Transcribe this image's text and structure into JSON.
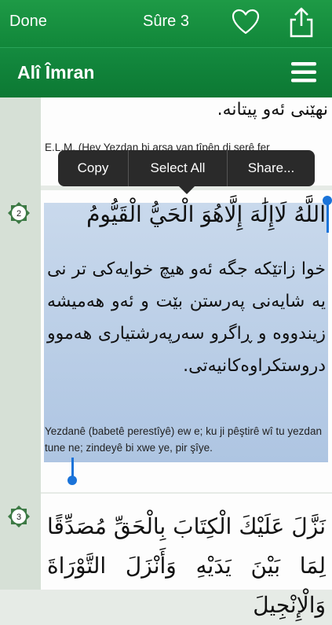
{
  "navbar": {
    "done_label": "Done",
    "title": "Sûre 3",
    "heart_icon": "heart-icon",
    "share_icon": "share-icon"
  },
  "surah_header": {
    "title": "Alî Îmran",
    "menu_icon": "hamburger-menu-icon"
  },
  "context_menu": {
    "items": [
      "Copy",
      "Select All",
      "Share..."
    ]
  },
  "verses": [
    {
      "kurdish": "نهێنی ئەو پیتانە.",
      "latin": "E.L.M. (Hey Yezdan bi arsa van tîpên di serê fer"
    },
    {
      "number": "2",
      "arabic": "اللَّهُ لَاإِلَٰهَ إِلَّاهُوَ الْحَيُّ الْقَيُّومُ",
      "kurdish": "خوا زاتێکە جگە ئەو هیچ خوایەکی تر نی یە شایەنی پەرستن بێت و ئەو هەمیشە زیندووە و ڕاگرو سەرپەرشتیاری هەموو دروستکراوەکانیەتی.",
      "latin": "Yezdanê (babetê perestîyê) ew e; ku ji pêştirê wî tu yezdan tune ne; zindeyê bi xwe ye, pir şîye."
    },
    {
      "number": "3",
      "arabic": "نَزَّلَ عَلَيْكَ الْكِتَابَ بِالْحَقِّ مُصَدِّقًا لِمَا بَيْنَ يَدَيْهِ وَأَنْزَلَ التَّوْرَاةَ وَالْإِنْجِيلَ"
    }
  ],
  "colors": {
    "nav_green": "#1e9a46",
    "selection_blue": "#aec5e2",
    "handle_blue": "#1a73d9",
    "badge_green": "#3d7a45"
  }
}
